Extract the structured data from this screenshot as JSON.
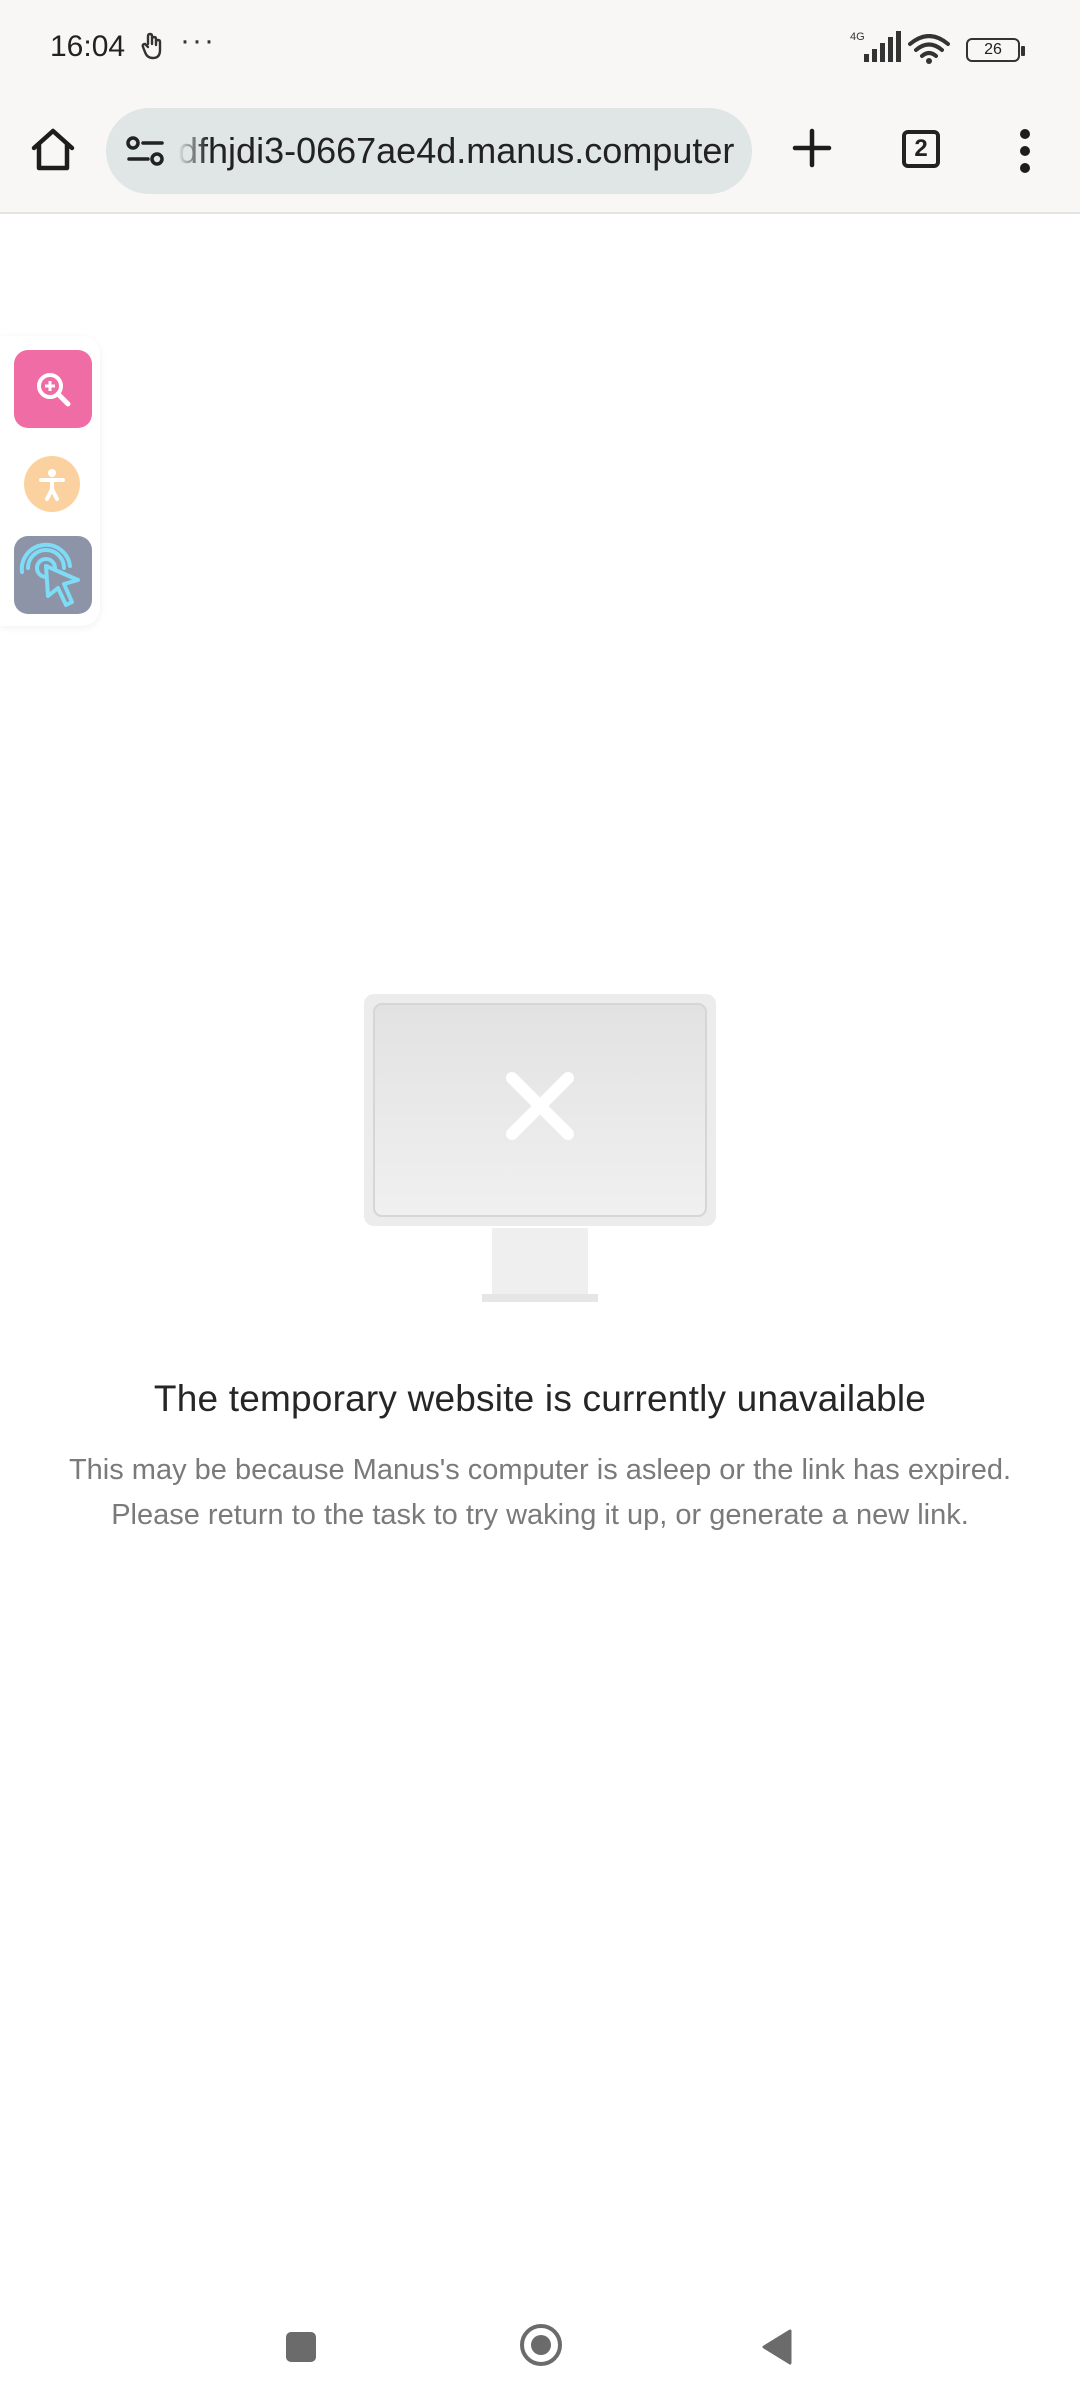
{
  "status_bar": {
    "time": "16:04",
    "battery_level": "26",
    "network": "4G",
    "icons": [
      "gesture-icon",
      "more-dots-icon",
      "signal-icon",
      "wifi-icon",
      "battery-icon"
    ]
  },
  "browser": {
    "url_visible": "dfhjdi3-0667ae4d.manus.computer",
    "tab_count": "2",
    "icons": [
      "home-icon",
      "site-info-icon",
      "new-tab-icon",
      "tabs-icon",
      "menu-icon"
    ]
  },
  "floating_tools": {
    "icons": [
      "zoom-icon",
      "accessibility-icon",
      "touch-cursor-icon"
    ],
    "colors": {
      "zoom": "#f06ca5",
      "accessibility": "#fbd29f",
      "cursor": "#8d94a8"
    }
  },
  "error": {
    "title": "The temporary website is currently unavailable",
    "line1": "This may be because Manus's computer is asleep or the link has expired.",
    "line2": "Please return to the task to try waking it up, or generate a new link."
  },
  "nav_bar": {
    "icons": [
      "recents-icon",
      "home-nav-icon",
      "back-icon"
    ]
  }
}
